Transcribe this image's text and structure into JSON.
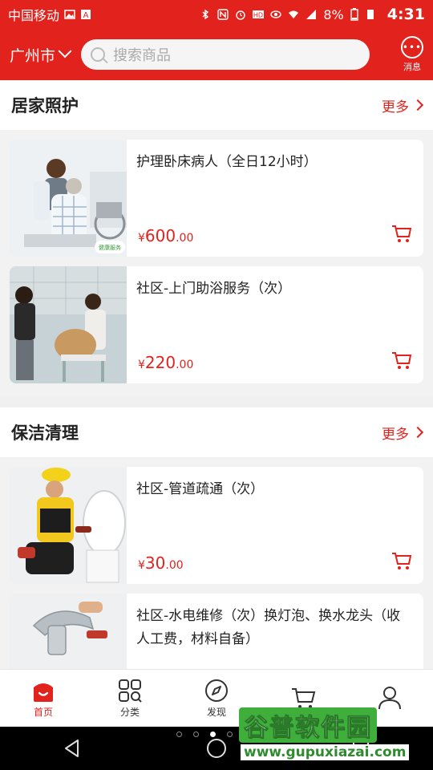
{
  "status_bar": {
    "carrier": "中国移动",
    "battery": "8%",
    "time": "4:31"
  },
  "header": {
    "city": "广州市",
    "search_placeholder": "搜索商品",
    "message_label": "消息",
    "accent_color": "#e2221c"
  },
  "sections": [
    {
      "title": "居家照护",
      "more_label": "更多",
      "items": [
        {
          "name": "护理卧床病人（全日12小时）",
          "currency": "¥",
          "price_int": "600",
          "price_dec": ".00",
          "image_tag": "健康服务"
        },
        {
          "name": "社区-上门助浴服务（次）",
          "currency": "¥",
          "price_int": "220",
          "price_dec": ".00"
        }
      ]
    },
    {
      "title": "保洁清理",
      "more_label": "更多",
      "items": [
        {
          "name": "社区-管道疏通（次）",
          "currency": "¥",
          "price_int": "30",
          "price_dec": ".00"
        },
        {
          "name": "社区-水电维修（次）换灯泡、换水龙头（收人工费，材料自备）",
          "currency": "¥",
          "price_int": "",
          "price_dec": ""
        }
      ]
    }
  ],
  "bottom_nav": [
    {
      "label": "首页",
      "icon": "home-icon",
      "active": true
    },
    {
      "label": "分类",
      "icon": "category-grid-icon",
      "active": false
    },
    {
      "label": "发现",
      "icon": "compass-icon",
      "active": false
    },
    {
      "label": "",
      "icon": "cart-icon",
      "active": false
    },
    {
      "label": "",
      "icon": "user-icon",
      "active": false
    }
  ],
  "watermark": {
    "title": "谷普软件园",
    "url": "www.gupuxiazai.com"
  }
}
